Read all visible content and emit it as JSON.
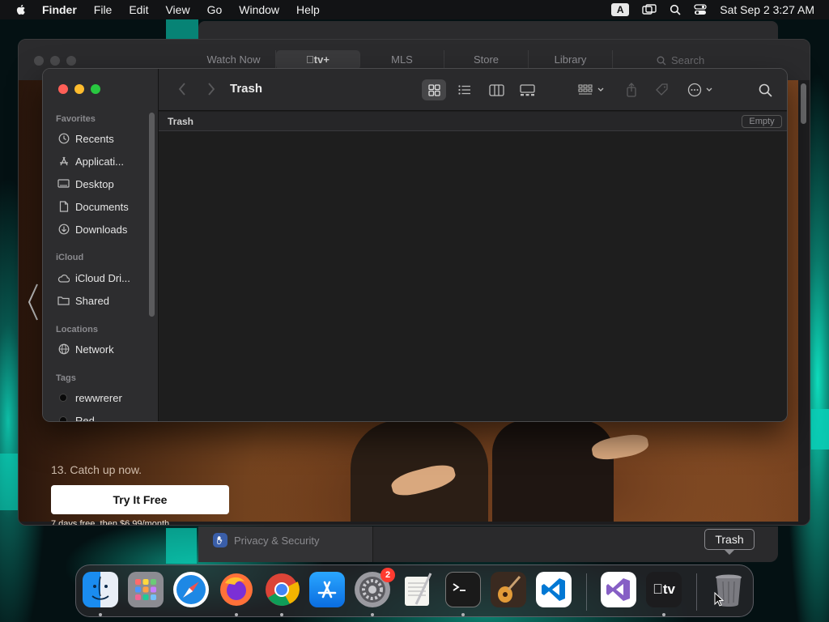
{
  "menubar": {
    "app_name": "Finder",
    "menus": [
      "File",
      "Edit",
      "View",
      "Go",
      "Window",
      "Help"
    ],
    "input_source": "A",
    "datetime": "Sat Sep 2  3:27 AM"
  },
  "tv_window": {
    "tabs": [
      "Watch Now",
      "tv+",
      "MLS",
      "Store",
      "Library"
    ],
    "search_placeholder": "Search",
    "hero_caption": "13. Catch up now.",
    "cta_label": "Try It Free",
    "price_text": "7 days free, then $6.99/month"
  },
  "settings_window": {
    "privacy_label": "Privacy & Security"
  },
  "finder": {
    "title": "Trash",
    "path_label": "Trash",
    "empty_label": "Empty",
    "sidebar": {
      "favorites_header": "Favorites",
      "favorites": [
        "Recents",
        "Applicati...",
        "Desktop",
        "Documents",
        "Downloads"
      ],
      "icloud_header": "iCloud",
      "icloud": [
        "iCloud Dri...",
        "Shared"
      ],
      "locations_header": "Locations",
      "locations": [
        "Network"
      ],
      "tags_header": "Tags",
      "tags": [
        "rewwrerer",
        "Red"
      ]
    }
  },
  "dock": {
    "tooltip": "Trash",
    "apps": [
      "Finder",
      "Launchpad",
      "Safari",
      "Firefox",
      "Chrome",
      "App Store",
      "System Settings",
      "TextEdit",
      "Terminal",
      "GarageBand",
      "Visual Studio Code",
      "Visual Studio",
      "Apple TV",
      "Trash"
    ],
    "settings_badge": "2",
    "tv_label": "tv"
  },
  "colors": {
    "close": "#ff5f57",
    "minimize": "#febc2e",
    "zoom": "#28c840",
    "badge": "#ff3b30"
  }
}
